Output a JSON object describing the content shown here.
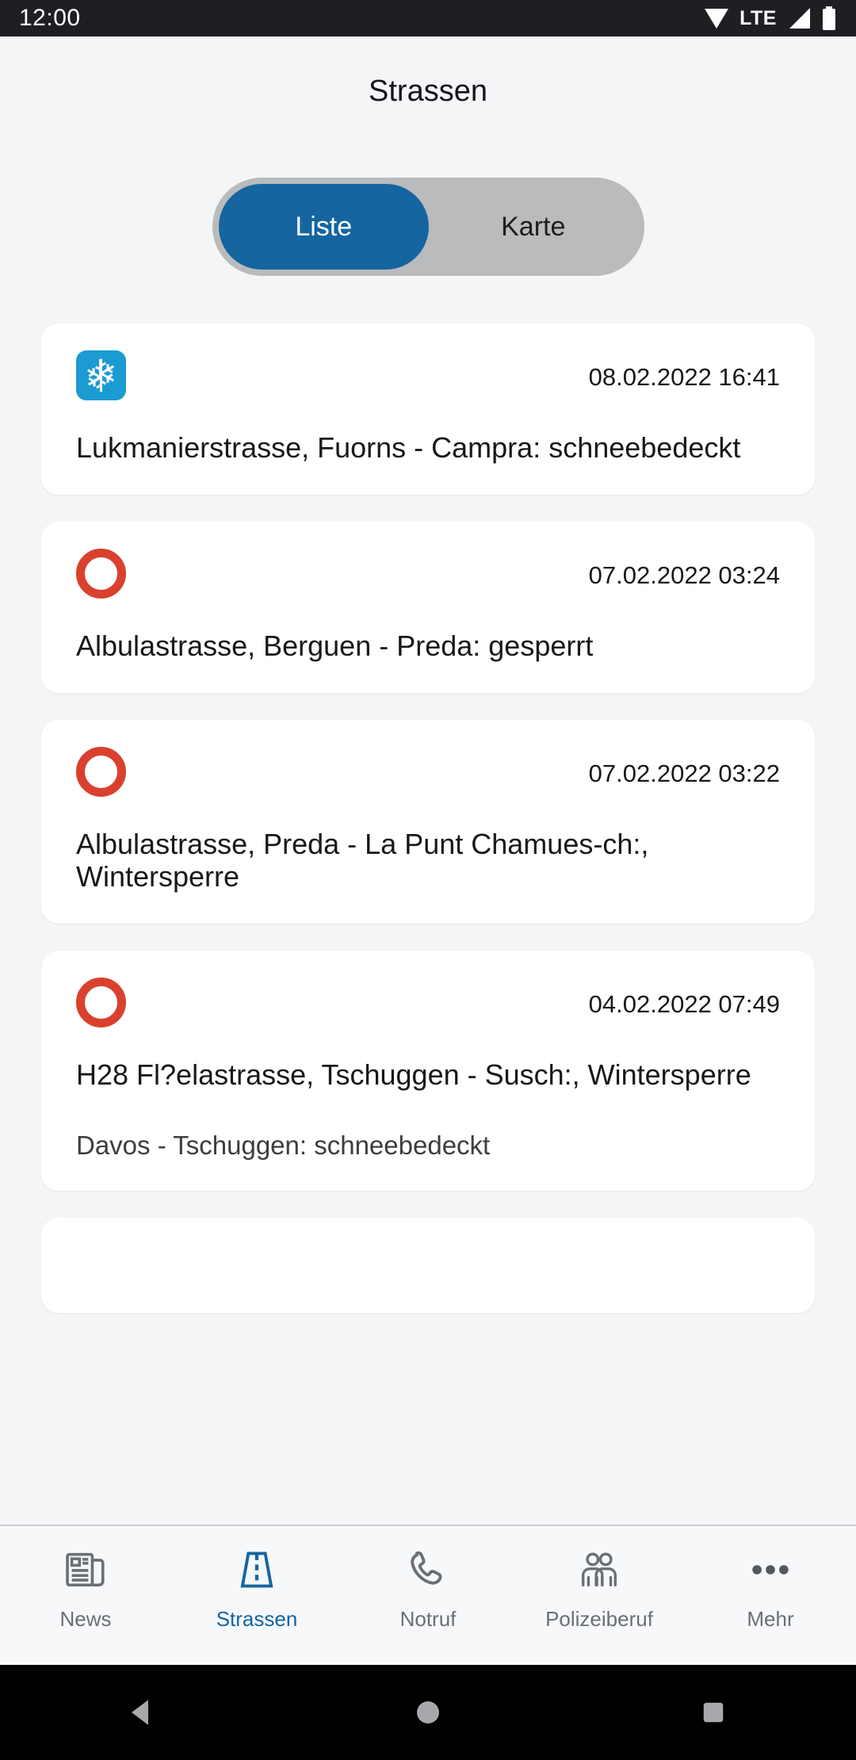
{
  "statusbar": {
    "clock": "12:00",
    "network_label": "LTE",
    "icons": [
      "wifi-icon",
      "signal-icon",
      "battery-icon"
    ]
  },
  "header": {
    "title": "Strassen"
  },
  "segmented_control": {
    "selected": "Liste",
    "options": [
      {
        "label": "Liste",
        "active": true
      },
      {
        "label": "Karte",
        "active": false
      }
    ]
  },
  "colors": {
    "accent_blue": "#1565a0",
    "snow_icon_blue": "#1b9bd1",
    "closed_red": "#d9412e",
    "page_bg": "#f4f5f7",
    "card_bg": "#ffffff",
    "statusbar_bg": "#1f1f23"
  },
  "list": {
    "cards": [
      {
        "icon": "snowflake-icon",
        "status": "snow",
        "timestamp": "08.02.2022 16:41",
        "title": "Lukmanierstrasse,  Fuorns - Campra: schneebedeckt",
        "subtitle": ""
      },
      {
        "icon": "road-closed-icon",
        "status": "closed",
        "timestamp": "07.02.2022 03:24",
        "title": "Albulastrasse,  Berguen - Preda: gesperrt",
        "subtitle": ""
      },
      {
        "icon": "road-closed-icon",
        "status": "closed",
        "timestamp": "07.02.2022 03:22",
        "title": "Albulastrasse,  Preda - La Punt Chamues-ch:, Wintersperre",
        "subtitle": ""
      },
      {
        "icon": "road-closed-icon",
        "status": "closed",
        "timestamp": "04.02.2022 07:49",
        "title": "H28 Fl?elastrasse,  Tschuggen - Susch:, Wintersperre",
        "subtitle": "Davos - Tschuggen: schneebedeckt"
      }
    ]
  },
  "bottom_nav": {
    "items": [
      {
        "label": "News",
        "icon": "newspaper-icon",
        "active": false
      },
      {
        "label": "Strassen",
        "icon": "road-icon",
        "active": true
      },
      {
        "label": "Notruf",
        "icon": "phone-icon",
        "active": false
      },
      {
        "label": "Polizeiberuf",
        "icon": "people-icon",
        "active": false
      },
      {
        "label": "Mehr",
        "icon": "ellipsis-icon",
        "active": false
      }
    ]
  },
  "android_nav": {
    "buttons": [
      {
        "name": "back-button",
        "icon": "triangle-back-icon"
      },
      {
        "name": "home-button",
        "icon": "circle-home-icon"
      },
      {
        "name": "recents-button",
        "icon": "square-recents-icon"
      }
    ]
  }
}
